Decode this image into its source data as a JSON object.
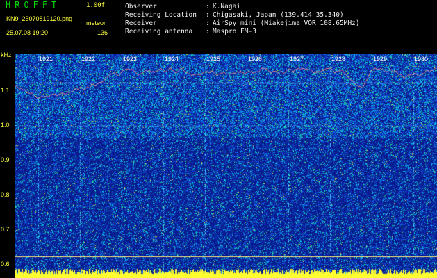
{
  "header": {
    "title": "HROFFT",
    "version": "1.00f",
    "filename": "KN9_25070819120.png",
    "mode": "meteor",
    "timestamp": "25.07.08 19:20",
    "count": "136"
  },
  "info": {
    "observer_label": "Observer",
    "observer_value": "K.Nagai",
    "location_label": "Receiving Location",
    "location_value": "Chigasaki, Japan (139.414 35.340)",
    "receiver_label": "Receiver",
    "receiver_value": "AirSpy mini (Miakejima VOR 108.65MHz)",
    "antenna_label": "Receiving antenna",
    "antenna_value": "Maspro FM-3"
  },
  "axis": {
    "unit": "kHz",
    "y_ticks": [
      "1.1",
      "1.0",
      "0.9",
      "0.8",
      "0.7",
      "0.6"
    ],
    "time_labels": [
      "1921",
      "1922",
      "1923",
      "1924",
      "1925",
      "1926",
      "1927",
      "1928",
      "1929",
      "1930"
    ]
  },
  "colors": {
    "background": "#000000",
    "plot_noise_base": "#0a1a9c",
    "header_green": "#00e000",
    "header_yellow": "#ffff40"
  }
}
